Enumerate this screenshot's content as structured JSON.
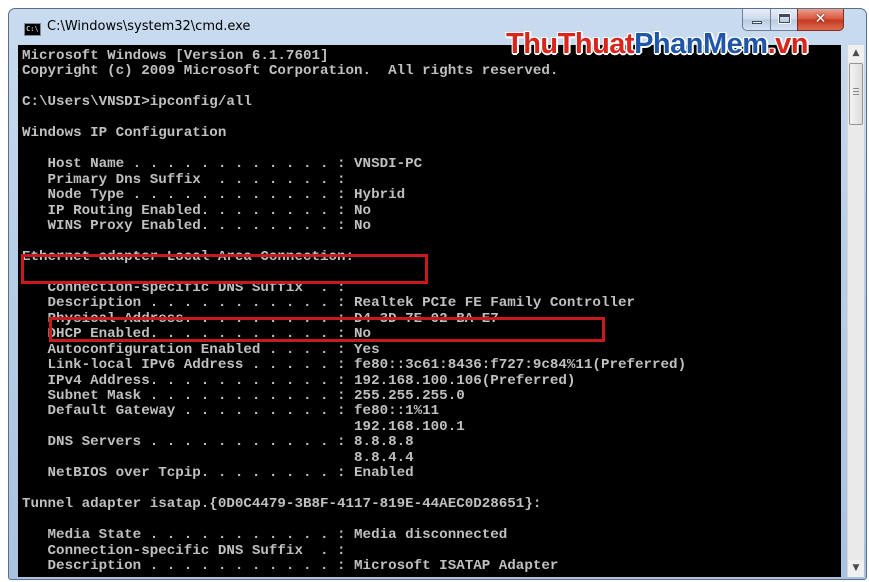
{
  "window": {
    "title": "C:\\Windows\\system32\\cmd.exe",
    "icon_text": "C:\\",
    "controls": {
      "minimize": "",
      "maximize": "",
      "close": "✕"
    }
  },
  "watermark": {
    "part1": "ThuThuat",
    "part2": "PhanMem",
    "part3": ".vn"
  },
  "console": {
    "lines": [
      "Microsoft Windows [Version 6.1.7601]",
      "Copyright (c) 2009 Microsoft Corporation.  All rights reserved.",
      "",
      "C:\\Users\\VNSDI>ipconfig/all",
      "",
      "Windows IP Configuration",
      "",
      "   Host Name . . . . . . . . . . . . : VNSDI-PC",
      "   Primary Dns Suffix  . . . . . . . :",
      "   Node Type . . . . . . . . . . . . : Hybrid",
      "   IP Routing Enabled. . . . . . . . : No",
      "   WINS Proxy Enabled. . . . . . . . : No",
      "",
      "Ethernet adapter Local Area Connection:",
      "",
      "   Connection-specific DNS Suffix  . :",
      "   Description . . . . . . . . . . . : Realtek PCIe FE Family Controller",
      "   Physical Address. . . . . . . . . : D4-3D-7E-02-BA-E7",
      "   DHCP Enabled. . . . . . . . . . . : No",
      "   Autoconfiguration Enabled . . . . : Yes",
      "   Link-local IPv6 Address . . . . . : fe80::3c61:8436:f727:9c84%11(Preferred)",
      "   IPv4 Address. . . . . . . . . . . : 192.168.100.106(Preferred)",
      "   Subnet Mask . . . . . . . . . . . : 255.255.255.0",
      "   Default Gateway . . . . . . . . . : fe80::1%11",
      "                                       192.168.100.1",
      "   DNS Servers . . . . . . . . . . . : 8.8.8.8",
      "                                       8.8.4.4",
      "   NetBIOS over Tcpip. . . . . . . . : Enabled",
      "",
      "Tunnel adapter isatap.{0D0C4479-3B8F-4117-819E-44AEC0D28651}:",
      "",
      "   Media State . . . . . . . . . . . : Media disconnected",
      "   Connection-specific DNS Suffix  . :",
      "   Description . . . . . . . . . . . : Microsoft ISATAP Adapter"
    ]
  },
  "scrollbar": {
    "up_arrow": "▲",
    "down_arrow": "▼"
  },
  "colors": {
    "highlight": "#c8191c",
    "console_text": "#c0c0c0",
    "console_bg": "#000000"
  }
}
